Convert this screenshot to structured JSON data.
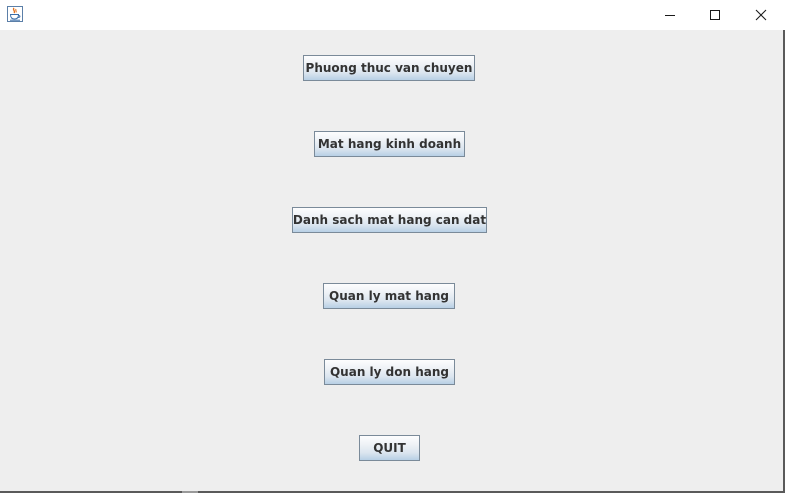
{
  "window": {
    "app_icon": "java-cup-icon",
    "controls": [
      "minimize-icon",
      "maximize-icon",
      "close-icon"
    ]
  },
  "menu": {
    "buttons": [
      {
        "label": "Phuong thuc van chuyen"
      },
      {
        "label": "Mat hang kinh doanh"
      },
      {
        "label": "Danh sach mat hang can dat"
      },
      {
        "label": "Quan ly mat hang"
      },
      {
        "label": "Quan ly don hang"
      },
      {
        "label": "QUIT"
      }
    ]
  },
  "colors": {
    "background": "#eeeeee",
    "button_border": "#7a8a99",
    "button_text": "#333333"
  }
}
